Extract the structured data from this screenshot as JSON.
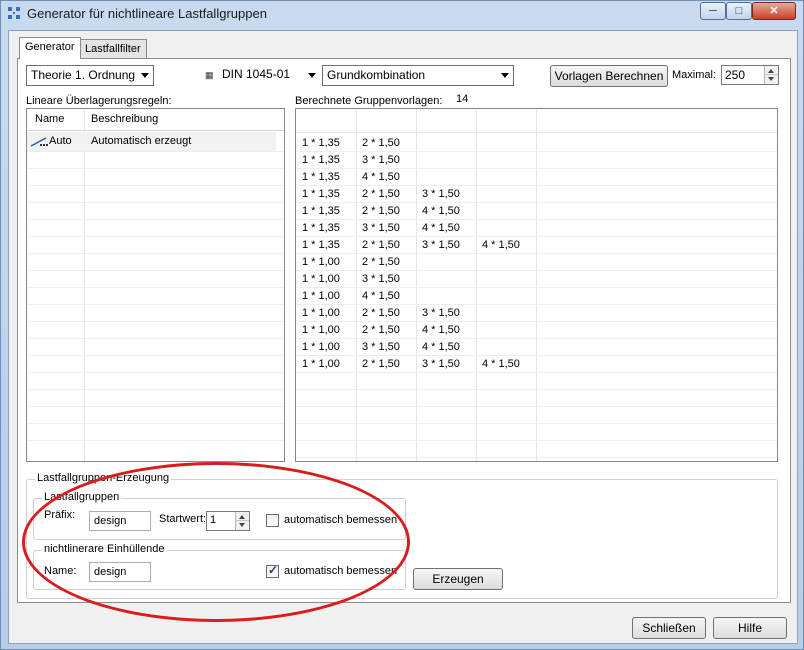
{
  "window": {
    "title": "Generator für nichtlineare Lastfallgruppen"
  },
  "tabs": [
    {
      "label": "Generator",
      "active": true
    },
    {
      "label": "Lastfallfilter",
      "active": false
    }
  ],
  "toolbar": {
    "theory_value": "Theorie 1. Ordnung",
    "norm_value": "DIN 1045-01",
    "combination_value": "Grundkombination",
    "compute_button": "Vorlagen Berechnen",
    "max_label": "Maximal:",
    "max_value": "250"
  },
  "rules_panel": {
    "title": "Lineare Überlagerungsregeln:",
    "columns": [
      "Name",
      "Beschreibung"
    ],
    "rows": [
      {
        "name": "Auto",
        "description": "Automatisch erzeugt"
      }
    ]
  },
  "groups_panel": {
    "title": "Berechnete Gruppenvorlagen:",
    "count": "14",
    "rows": [
      [
        "1 * 1,35",
        "2 * 1,50",
        "",
        ""
      ],
      [
        "1 * 1,35",
        "3 * 1,50",
        "",
        ""
      ],
      [
        "1 * 1,35",
        "4 * 1,50",
        "",
        ""
      ],
      [
        "1 * 1,35",
        "2 * 1,50",
        "3 * 1,50",
        ""
      ],
      [
        "1 * 1,35",
        "2 * 1,50",
        "4 * 1,50",
        ""
      ],
      [
        "1 * 1,35",
        "3 * 1,50",
        "4 * 1,50",
        ""
      ],
      [
        "1 * 1,35",
        "2 * 1,50",
        "3 * 1,50",
        "4 * 1,50"
      ],
      [
        "1 * 1,00",
        "2 * 1,50",
        "",
        ""
      ],
      [
        "1 * 1,00",
        "3 * 1,50",
        "",
        ""
      ],
      [
        "1 * 1,00",
        "4 * 1,50",
        "",
        ""
      ],
      [
        "1 * 1,00",
        "2 * 1,50",
        "3 * 1,50",
        ""
      ],
      [
        "1 * 1,00",
        "2 * 1,50",
        "4 * 1,50",
        ""
      ],
      [
        "1 * 1,00",
        "3 * 1,50",
        "4 * 1,50",
        ""
      ],
      [
        "1 * 1,00",
        "2 * 1,50",
        "3 * 1,50",
        "4 * 1,50"
      ]
    ]
  },
  "generation": {
    "title": "Lastfallgruppen-Erzeugung",
    "load_groups": {
      "title": "Lastfallgruppen",
      "prefix_label": "Präfix:",
      "prefix_value": "design",
      "start_label": "Startwert:",
      "start_value": "1",
      "auto_label": "automatisch bemessen",
      "auto_checked": false
    },
    "envelope": {
      "title": "nichtlinerare Einhüllende",
      "name_label": "Name:",
      "name_value": "design",
      "auto_label": "automatisch bemessen",
      "auto_checked": true
    },
    "create_button": "Erzeugen"
  },
  "footer": {
    "close_button": "Schließen",
    "help_button": "Hilfe"
  },
  "colors": {
    "annotation": "#d91d1d",
    "titlebar": "#c9daf0",
    "close_button": "#c9402b"
  }
}
